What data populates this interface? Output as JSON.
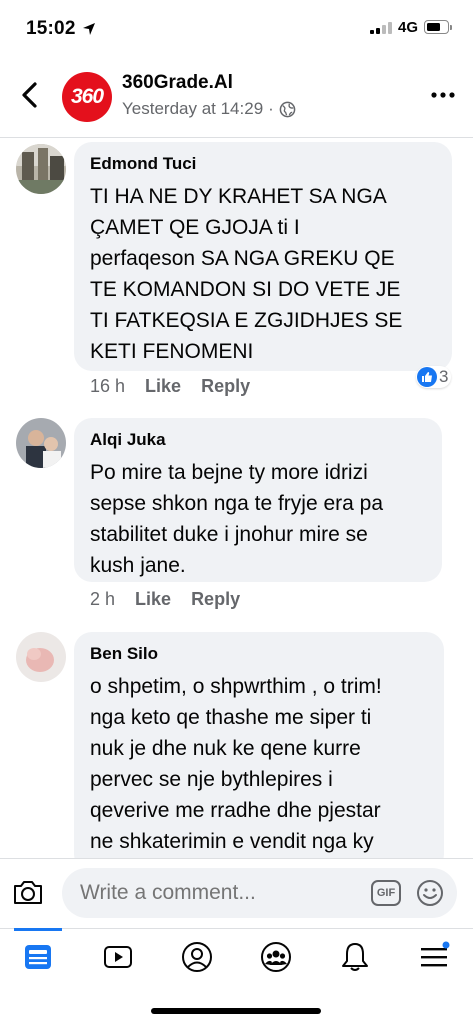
{
  "status_bar": {
    "time": "15:02",
    "network": "4G"
  },
  "post_header": {
    "page_name": "360Grade.Al",
    "logo_text": "360",
    "timestamp": "Yesterday at 14:29",
    "separator": "·"
  },
  "comments": [
    {
      "author": "Edmond Tuci",
      "lines": [
        "TI HA NE DY KRAHET SA NGA",
        "ÇAMET QE GJOJA ti I",
        "perfaqeson SA NGA GREKU QE",
        "TE KOMANDON SI DO VETE JE",
        "TI FATKEQSIA E ZGJIDHJES SE",
        "KETI FENOMENI"
      ],
      "time": "16 h",
      "like_label": "Like",
      "reply_label": "Reply",
      "reaction_count": "3"
    },
    {
      "author": "Alqi Juka",
      "lines": [
        "Po mire ta bejne ty more idrizi",
        "sepse shkon nga te fryje era pa",
        "stabilitet duke i jnohur mire se",
        "kush jane."
      ],
      "time": "2 h",
      "like_label": "Like",
      "reply_label": "Reply"
    },
    {
      "author": "Ben Silo",
      "lines": [
        "o shpetim, o shpwrthim , o trim!",
        "nga keto qe thashe me siper ti",
        "nuk je dhe nuk ke qene kurre",
        "pervec se nje bythlepires i",
        "qeverive me rradhe dhe pjestar",
        "ne shkaterimin e vendit nga ky"
      ]
    }
  ],
  "composer": {
    "placeholder": "Write a comment...",
    "gif_label": "GIF"
  },
  "colors": {
    "accent": "#1877f2",
    "logo_red": "#e4101c",
    "bubble": "#f0f2f5",
    "muted": "#65676b"
  }
}
